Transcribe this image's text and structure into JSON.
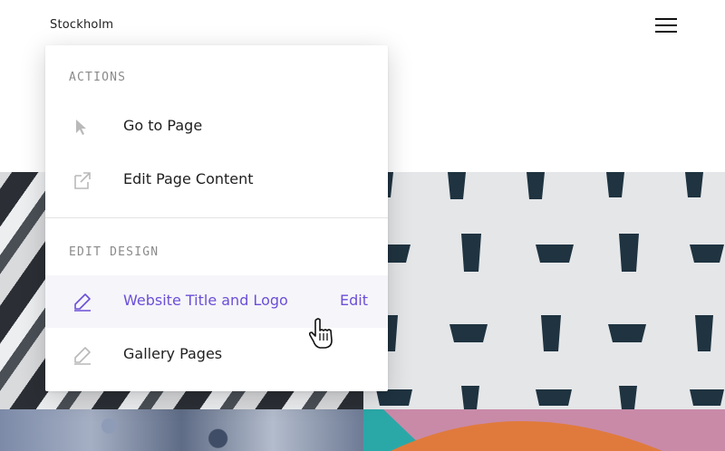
{
  "header": {
    "site_title": "Stockholm",
    "menu_icon": "hamburger-menu-icon"
  },
  "menu": {
    "actions_heading": "ACTIONS",
    "actions": [
      {
        "label": "Go to Page",
        "icon": "pointer-arrow-icon"
      },
      {
        "label": "Edit Page Content",
        "icon": "external-link-icon"
      }
    ],
    "design_heading": "EDIT DESIGN",
    "design": [
      {
        "label": "Website Title and Logo",
        "icon": "pencil-icon",
        "action_label": "Edit",
        "state": "hovered"
      },
      {
        "label": "Gallery Pages",
        "icon": "pencil-icon"
      }
    ]
  },
  "colors": {
    "accent": "#6b4fd8",
    "hover_row": "#f6f5f9",
    "heading_gray": "#8a8a8a"
  },
  "cursor": "hand-pointer-icon"
}
